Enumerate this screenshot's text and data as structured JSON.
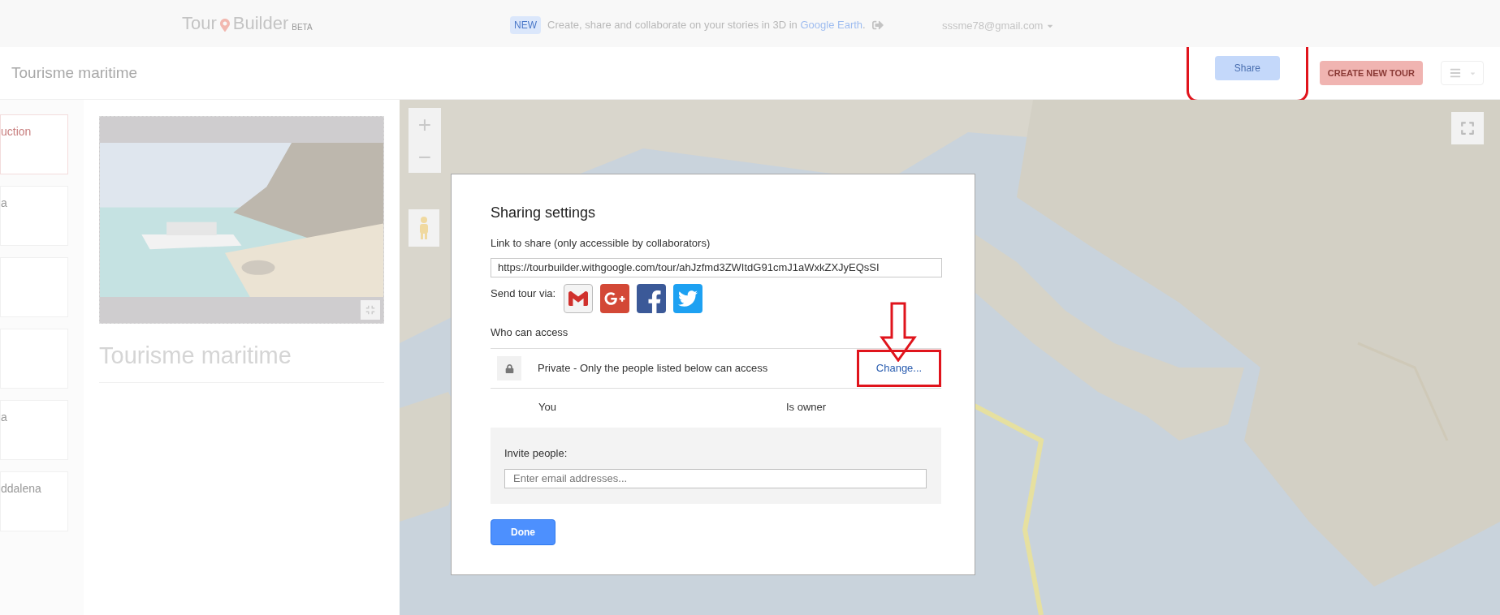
{
  "header": {
    "logo_left": "Tour",
    "logo_right": "Builder",
    "logo_tag": "BETA",
    "badge": "NEW",
    "announcement": "Create, share and collaborate on your stories in 3D in ",
    "announcement_link": "Google Earth",
    "announcement_end": ".",
    "account": "sssme78@gmail.com"
  },
  "toolbar": {
    "tour_title": "Tourisme maritime",
    "share": "Share",
    "create": "CREATE NEW TOUR"
  },
  "sidebar": {
    "items": [
      {
        "label": "uction",
        "selected": true
      },
      {
        "label": "a",
        "selected": false
      },
      {
        "selected": false
      },
      {
        "selected": false
      },
      {
        "label": "a",
        "selected": false
      },
      {
        "label": "ddalena",
        "selected": false
      }
    ]
  },
  "cover": {
    "title": "Tourisme maritime"
  },
  "map": {
    "zoom_in": "+",
    "zoom_out": "−"
  },
  "dialog": {
    "title": "Sharing settings",
    "link_label": "Link to share (only accessible by collaborators)",
    "link_value": "https://tourbuilder.withgoogle.com/tour/ahJzfmd3ZWItdG91cmJ1aWxkZXJyEQsSI",
    "send_label": "Send tour via:",
    "access_heading": "Who can access",
    "access_text": "Private - Only the people listed below can access",
    "change": "Change...",
    "members": [
      {
        "name": "You",
        "role": "Is owner"
      }
    ],
    "invite_label": "Invite people:",
    "invite_placeholder": "Enter email addresses...",
    "done": "Done"
  }
}
